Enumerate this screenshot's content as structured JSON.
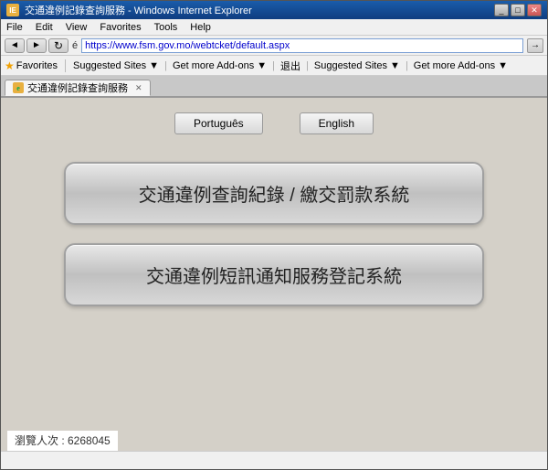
{
  "titleBar": {
    "title": "交通違例記錄查詢服務 - Windows Internet Explorer",
    "iconLabel": "IE"
  },
  "menuBar": {
    "items": [
      "File",
      "Edit",
      "View",
      "Favorites",
      "Tools",
      "Help"
    ]
  },
  "addressBar": {
    "backLabel": "◄",
    "forwardLabel": "►",
    "label": "é",
    "url": "https://www.fsm.gov.mo/webtcket/default.aspx"
  },
  "favoritesBar": {
    "starLabel": "★",
    "favoritesLabel": "Favorites",
    "suggestedSites1": "Suggested Sites ▼",
    "getMoreAddons1": "Get more Add-ons ▼",
    "exit": "退出",
    "suggestedSites2": "Suggested Sites ▼",
    "getMoreAddons2": "Get more Add-ons ▼"
  },
  "tabBar": {
    "tabLabel": "交通違例記錄查詢服務",
    "tabIconLabel": "e"
  },
  "languageButtons": {
    "portugues": "Português",
    "english": "English"
  },
  "mainButtons": {
    "button1": "交通違例查詢紀錄 / 繳交罰款系統",
    "button2": "交通違例短訊通知服務登記系統"
  },
  "visitorCount": {
    "label": "瀏覽人次 : 6268045"
  },
  "statusBar": {
    "text": ""
  }
}
